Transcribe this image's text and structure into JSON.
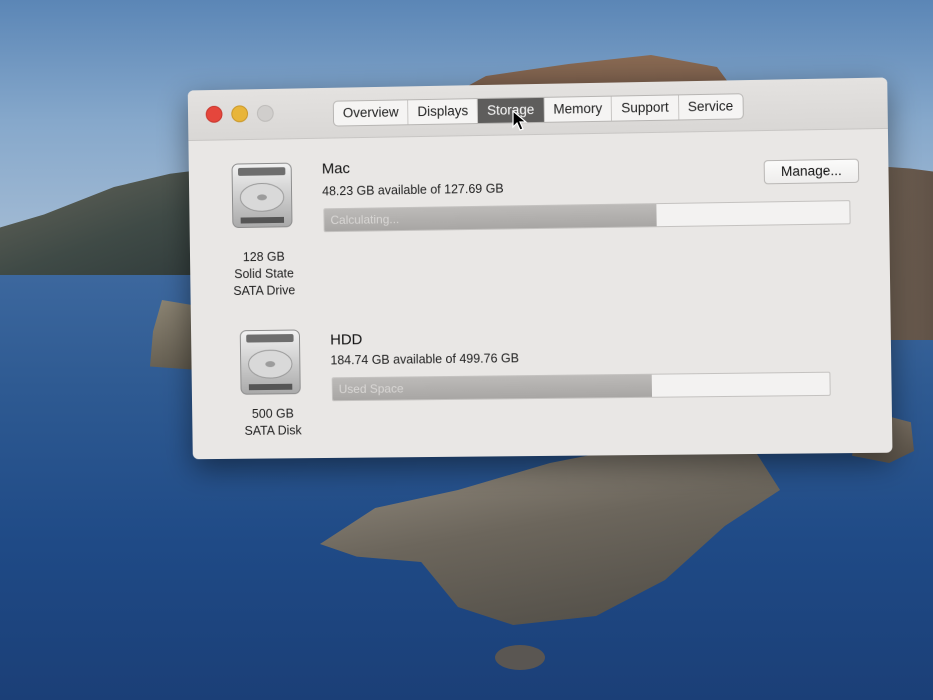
{
  "window": {
    "tabs": [
      {
        "label": "Overview"
      },
      {
        "label": "Displays"
      },
      {
        "label": "Storage"
      },
      {
        "label": "Memory"
      },
      {
        "label": "Support"
      },
      {
        "label": "Service"
      }
    ],
    "active_tab": "Storage"
  },
  "drives": [
    {
      "name": "Mac",
      "available": "48.23 GB available of 127.69 GB",
      "caption": [
        "128 GB",
        "Solid State",
        "SATA Drive"
      ],
      "bar_label": "Calculating...",
      "used_fraction": 0.635,
      "manage_label": "Manage..."
    },
    {
      "name": "HDD",
      "available": "184.74 GB available of 499.76 GB",
      "caption": [
        "500 GB",
        "SATA Disk"
      ],
      "bar_label": "Used Space",
      "used_fraction": 0.645
    }
  ],
  "colors": {
    "close": "#e5463c",
    "minimize": "#e8b53a",
    "zoom": "#d0cecc",
    "active_tab": "#5e5d5c"
  }
}
